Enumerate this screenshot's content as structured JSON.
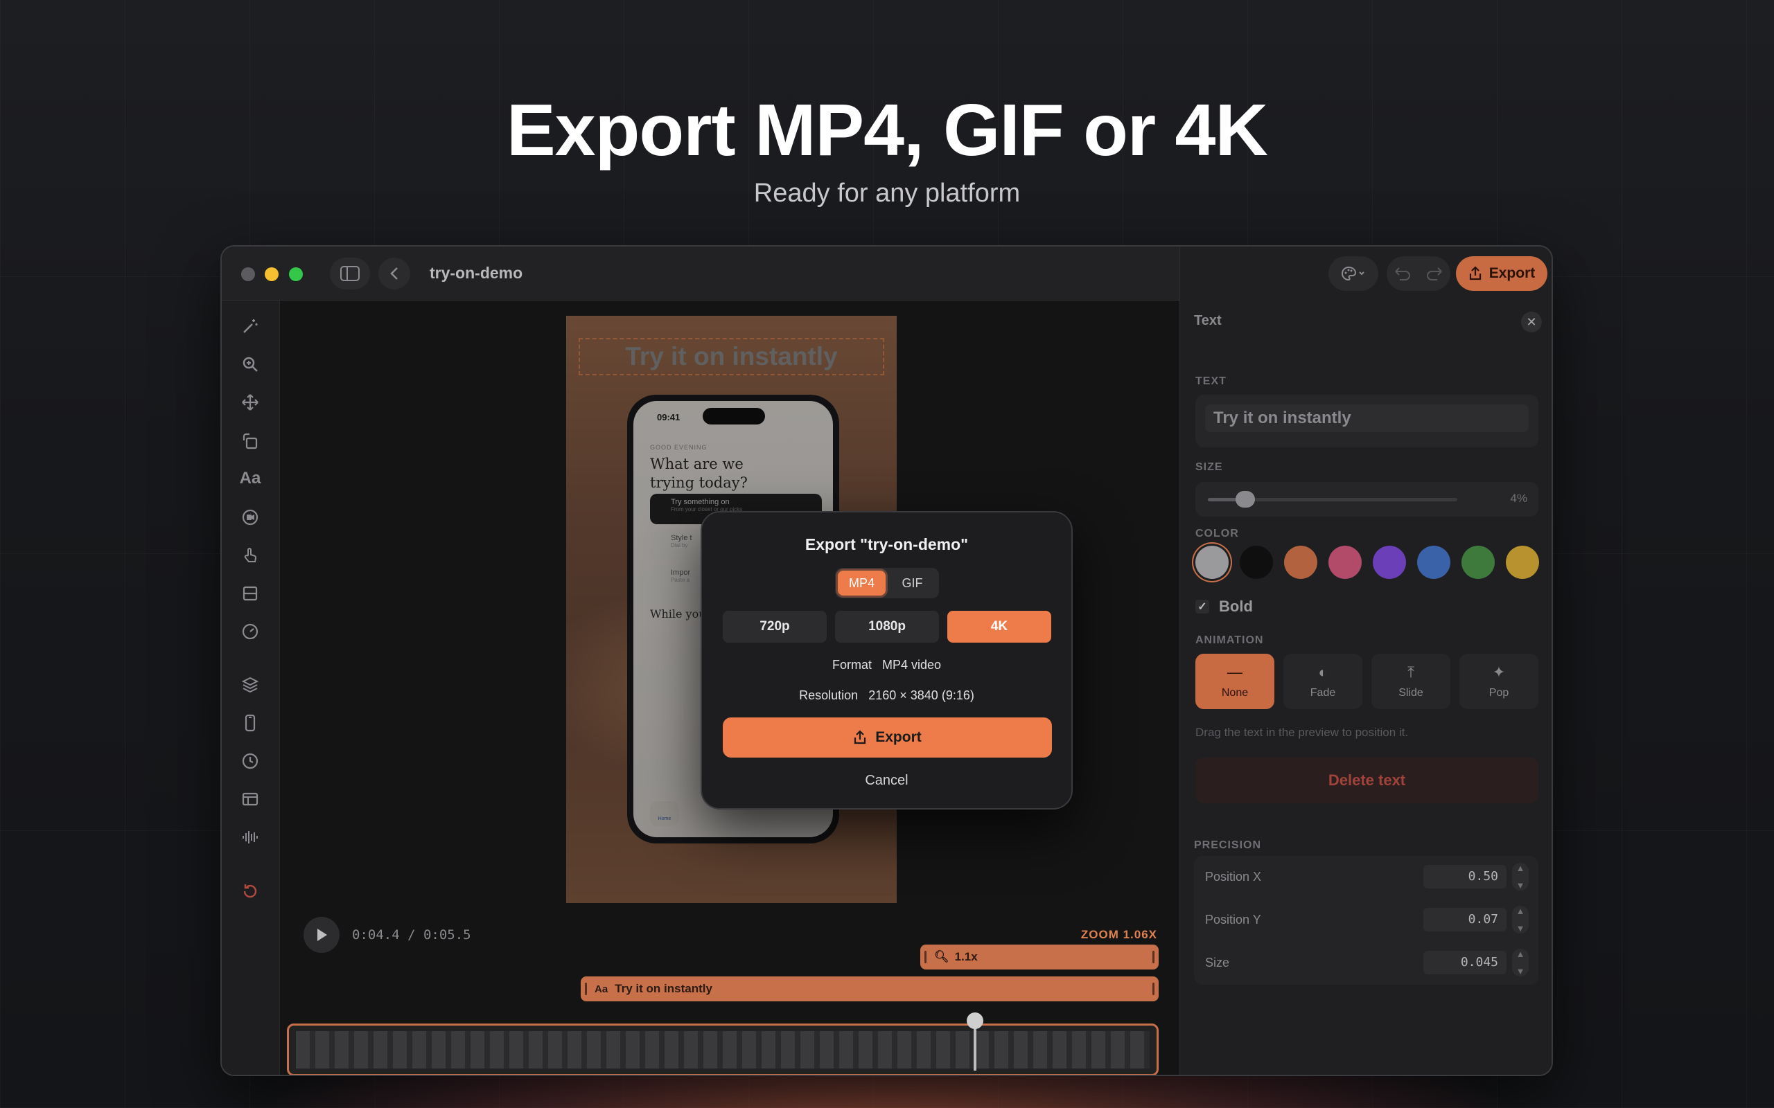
{
  "hero": {
    "title": "Export MP4, GIF or 4K",
    "subtitle": "Ready for any platform"
  },
  "window": {
    "doc_title": "try-on-demo"
  },
  "toolbar": {
    "export_label": "Export"
  },
  "sidebar": {
    "icons": [
      "magic-wand-icon",
      "zoom-icon",
      "move-icon",
      "rotate-icon",
      "text-icon",
      "record-icon",
      "tap-icon",
      "layout-icon",
      "speed-icon",
      "layers-icon",
      "device-icon",
      "clock-icon",
      "template-icon",
      "audio-icon",
      "reset-icon"
    ],
    "text_tool_label": "Aa"
  },
  "preview": {
    "caption": "Try it on instantly",
    "phone": {
      "time": "09:41",
      "greeting": "GOOD EVENING",
      "headline_1": "What are we",
      "headline_2": "trying today?",
      "card_1": "Try something on",
      "card_1_sub": "From your closet or our picks",
      "card_2": "Style t",
      "card_2_sub": "Dial by",
      "card_3": "Impor",
      "card_3_sub": "Paste a",
      "section": "While you",
      "tab": "Home"
    }
  },
  "player": {
    "time": "0:04.4 / 0:05.5",
    "zoom": "ZOOM 1.06X"
  },
  "timeline": {
    "zoom_track": "1.1x",
    "text_track_icon": "Aa",
    "text_track": "Try it on instantly",
    "playhead_fraction": 0.8
  },
  "panel": {
    "title": "Text",
    "text_label": "TEXT",
    "text_value": "Try it on instantly",
    "size_label": "SIZE",
    "size_value": "4%",
    "size_fraction": 0.15,
    "color_label": "COLOR",
    "colors": [
      "#9a9a9c",
      "#0f0f10",
      "#b3623f",
      "#b24b6a",
      "#6a3fb8",
      "#3a62a8",
      "#3e7a3c",
      "#b8922e"
    ],
    "bold_label": "Bold",
    "bold_checked": "✓",
    "animation_label": "ANIMATION",
    "animations": [
      {
        "label": "None",
        "icon": "—"
      },
      {
        "label": "Fade",
        "icon": "◐"
      },
      {
        "label": "Slide",
        "icon": "⤒"
      },
      {
        "label": "Pop",
        "icon": "✦"
      }
    ],
    "hint": "Drag the text in the preview to position it.",
    "delete_label": "Delete text",
    "precision_label": "PRECISION",
    "precision": [
      {
        "label": "Position X",
        "value": "0.50"
      },
      {
        "label": "Position Y",
        "value": "0.07"
      },
      {
        "label": "Size",
        "value": "0.045"
      }
    ]
  },
  "modal": {
    "title": "Export \"try-on-demo\"",
    "formats": [
      "MP4",
      "GIF"
    ],
    "resolutions": [
      "720p",
      "1080p",
      "4K"
    ],
    "format_key": "Format",
    "format_value": "MP4 video",
    "resolution_key": "Resolution",
    "resolution_value": "2160 × 3840 (9:16)",
    "export_label": "Export",
    "cancel_label": "Cancel"
  },
  "colors": {
    "accent": "#ed7c4a",
    "track": "#c8704a"
  }
}
